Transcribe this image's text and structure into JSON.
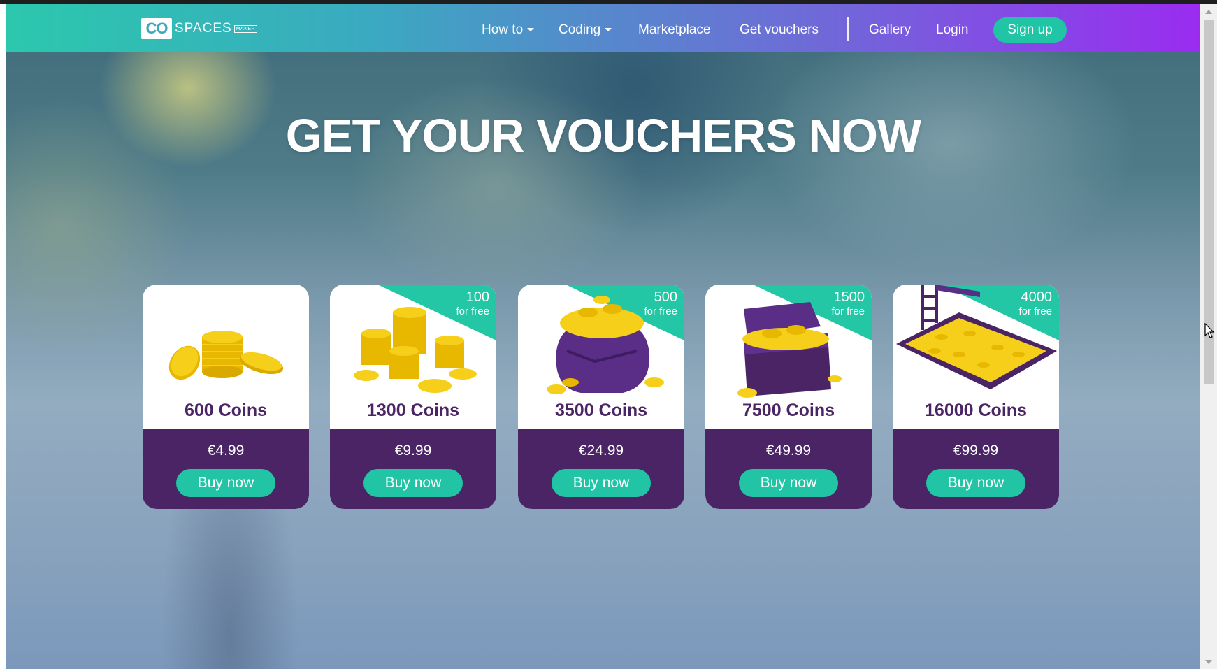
{
  "nav": {
    "logo_mark": "CO",
    "logo_text": "SPACES",
    "logo_tag": "MAKER",
    "items": [
      {
        "label": "How to",
        "dropdown": true
      },
      {
        "label": "Coding",
        "dropdown": true
      },
      {
        "label": "Marketplace",
        "dropdown": false
      },
      {
        "label": "Get vouchers",
        "dropdown": false
      },
      {
        "label": "Gallery",
        "dropdown": false
      },
      {
        "label": "Login",
        "dropdown": false
      }
    ],
    "signup_label": "Sign up"
  },
  "hero": {
    "headline": "GET YOUR VOUCHERS NOW"
  },
  "cards": [
    {
      "title": "600 Coins",
      "price": "€4.99",
      "bonus": "",
      "bonus_sub": "",
      "button": "Buy now",
      "art": "coins-icon"
    },
    {
      "title": "1300 Coins",
      "price": "€9.99",
      "bonus": "100",
      "bonus_sub": "for free",
      "button": "Buy now",
      "art": "coin-stacks-icon"
    },
    {
      "title": "3500 Coins",
      "price": "€24.99",
      "bonus": "500",
      "bonus_sub": "for free",
      "button": "Buy now",
      "art": "coin-bag-icon"
    },
    {
      "title": "7500 Coins",
      "price": "€49.99",
      "bonus": "1500",
      "bonus_sub": "for free",
      "button": "Buy now",
      "art": "treasure-chest-icon"
    },
    {
      "title": "16000 Coins",
      "price": "€99.99",
      "bonus": "4000",
      "bonus_sub": "for free",
      "button": "Buy now",
      "art": "coin-pool-icon"
    }
  ],
  "colors": {
    "accent": "#21c4a5",
    "card_purple": "#4a2464",
    "nav_gradient_start": "#2bc8ad",
    "nav_gradient_end": "#9a2cf0"
  }
}
